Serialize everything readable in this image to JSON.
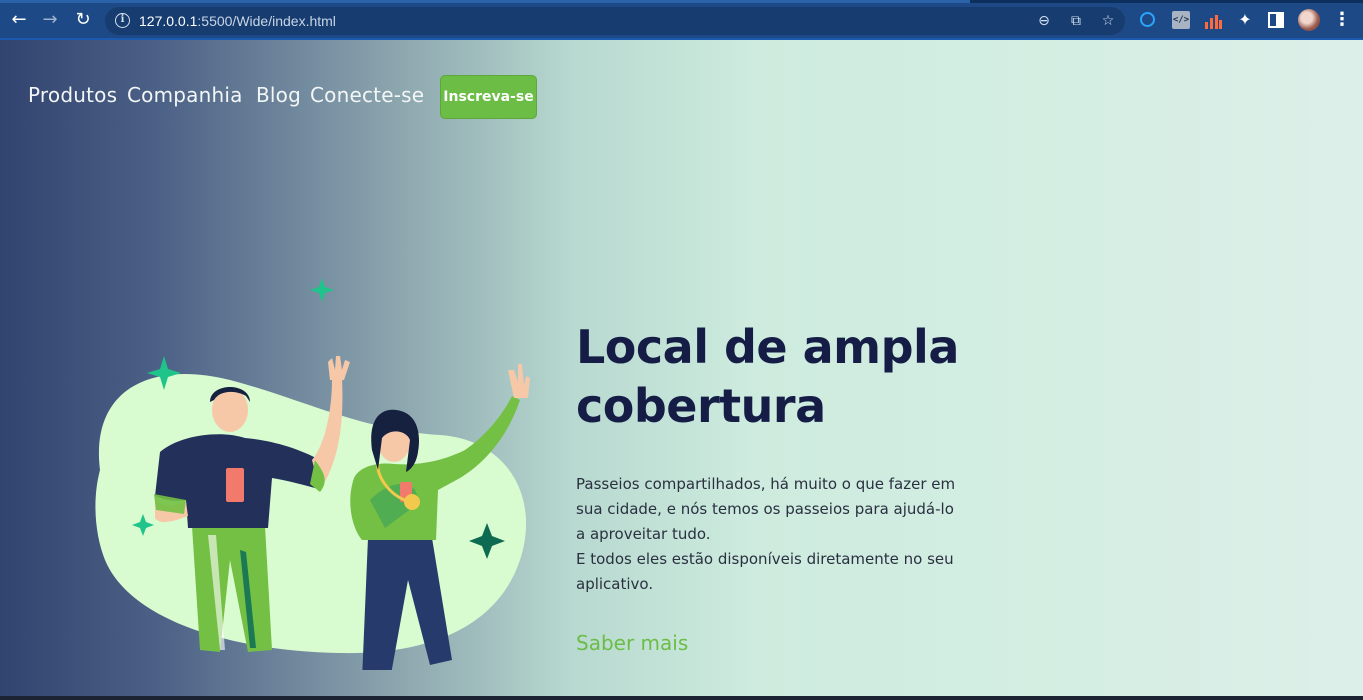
{
  "browser": {
    "url_host": "127.0.0.1",
    "url_path": ":5500/Wide/index.html",
    "icons": [
      "back-arrow-icon",
      "forward-arrow-icon",
      "reload-icon",
      "info-icon",
      "zoom-out-icon",
      "share-icon",
      "star-icon",
      "extension-search-icon",
      "extension-code-icon",
      "extension-chart-icon",
      "puzzle-icon",
      "side-panel-icon",
      "profile-avatar",
      "kebab-menu-icon"
    ]
  },
  "nav": {
    "links": [
      "Produtos",
      "Companhia",
      "Blog",
      "Conecte-se"
    ],
    "signup_label": "Inscreva-se"
  },
  "hero": {
    "title_line1": "Local de ampla",
    "title_line2": "cobertura",
    "paragraph1": "Passeios compartilhados, há muito o que fazer em sua cidade, e nós temos os passeios para ajudá-lo a aproveitar tudo.",
    "paragraph2": "E todos eles estão disponíveis diretamente no seu aplicativo.",
    "cta_label": "Saber mais"
  },
  "colors": {
    "accent_green": "#6bbd45",
    "title_navy": "#151d46",
    "chrome_blue": "#1d4a86"
  }
}
